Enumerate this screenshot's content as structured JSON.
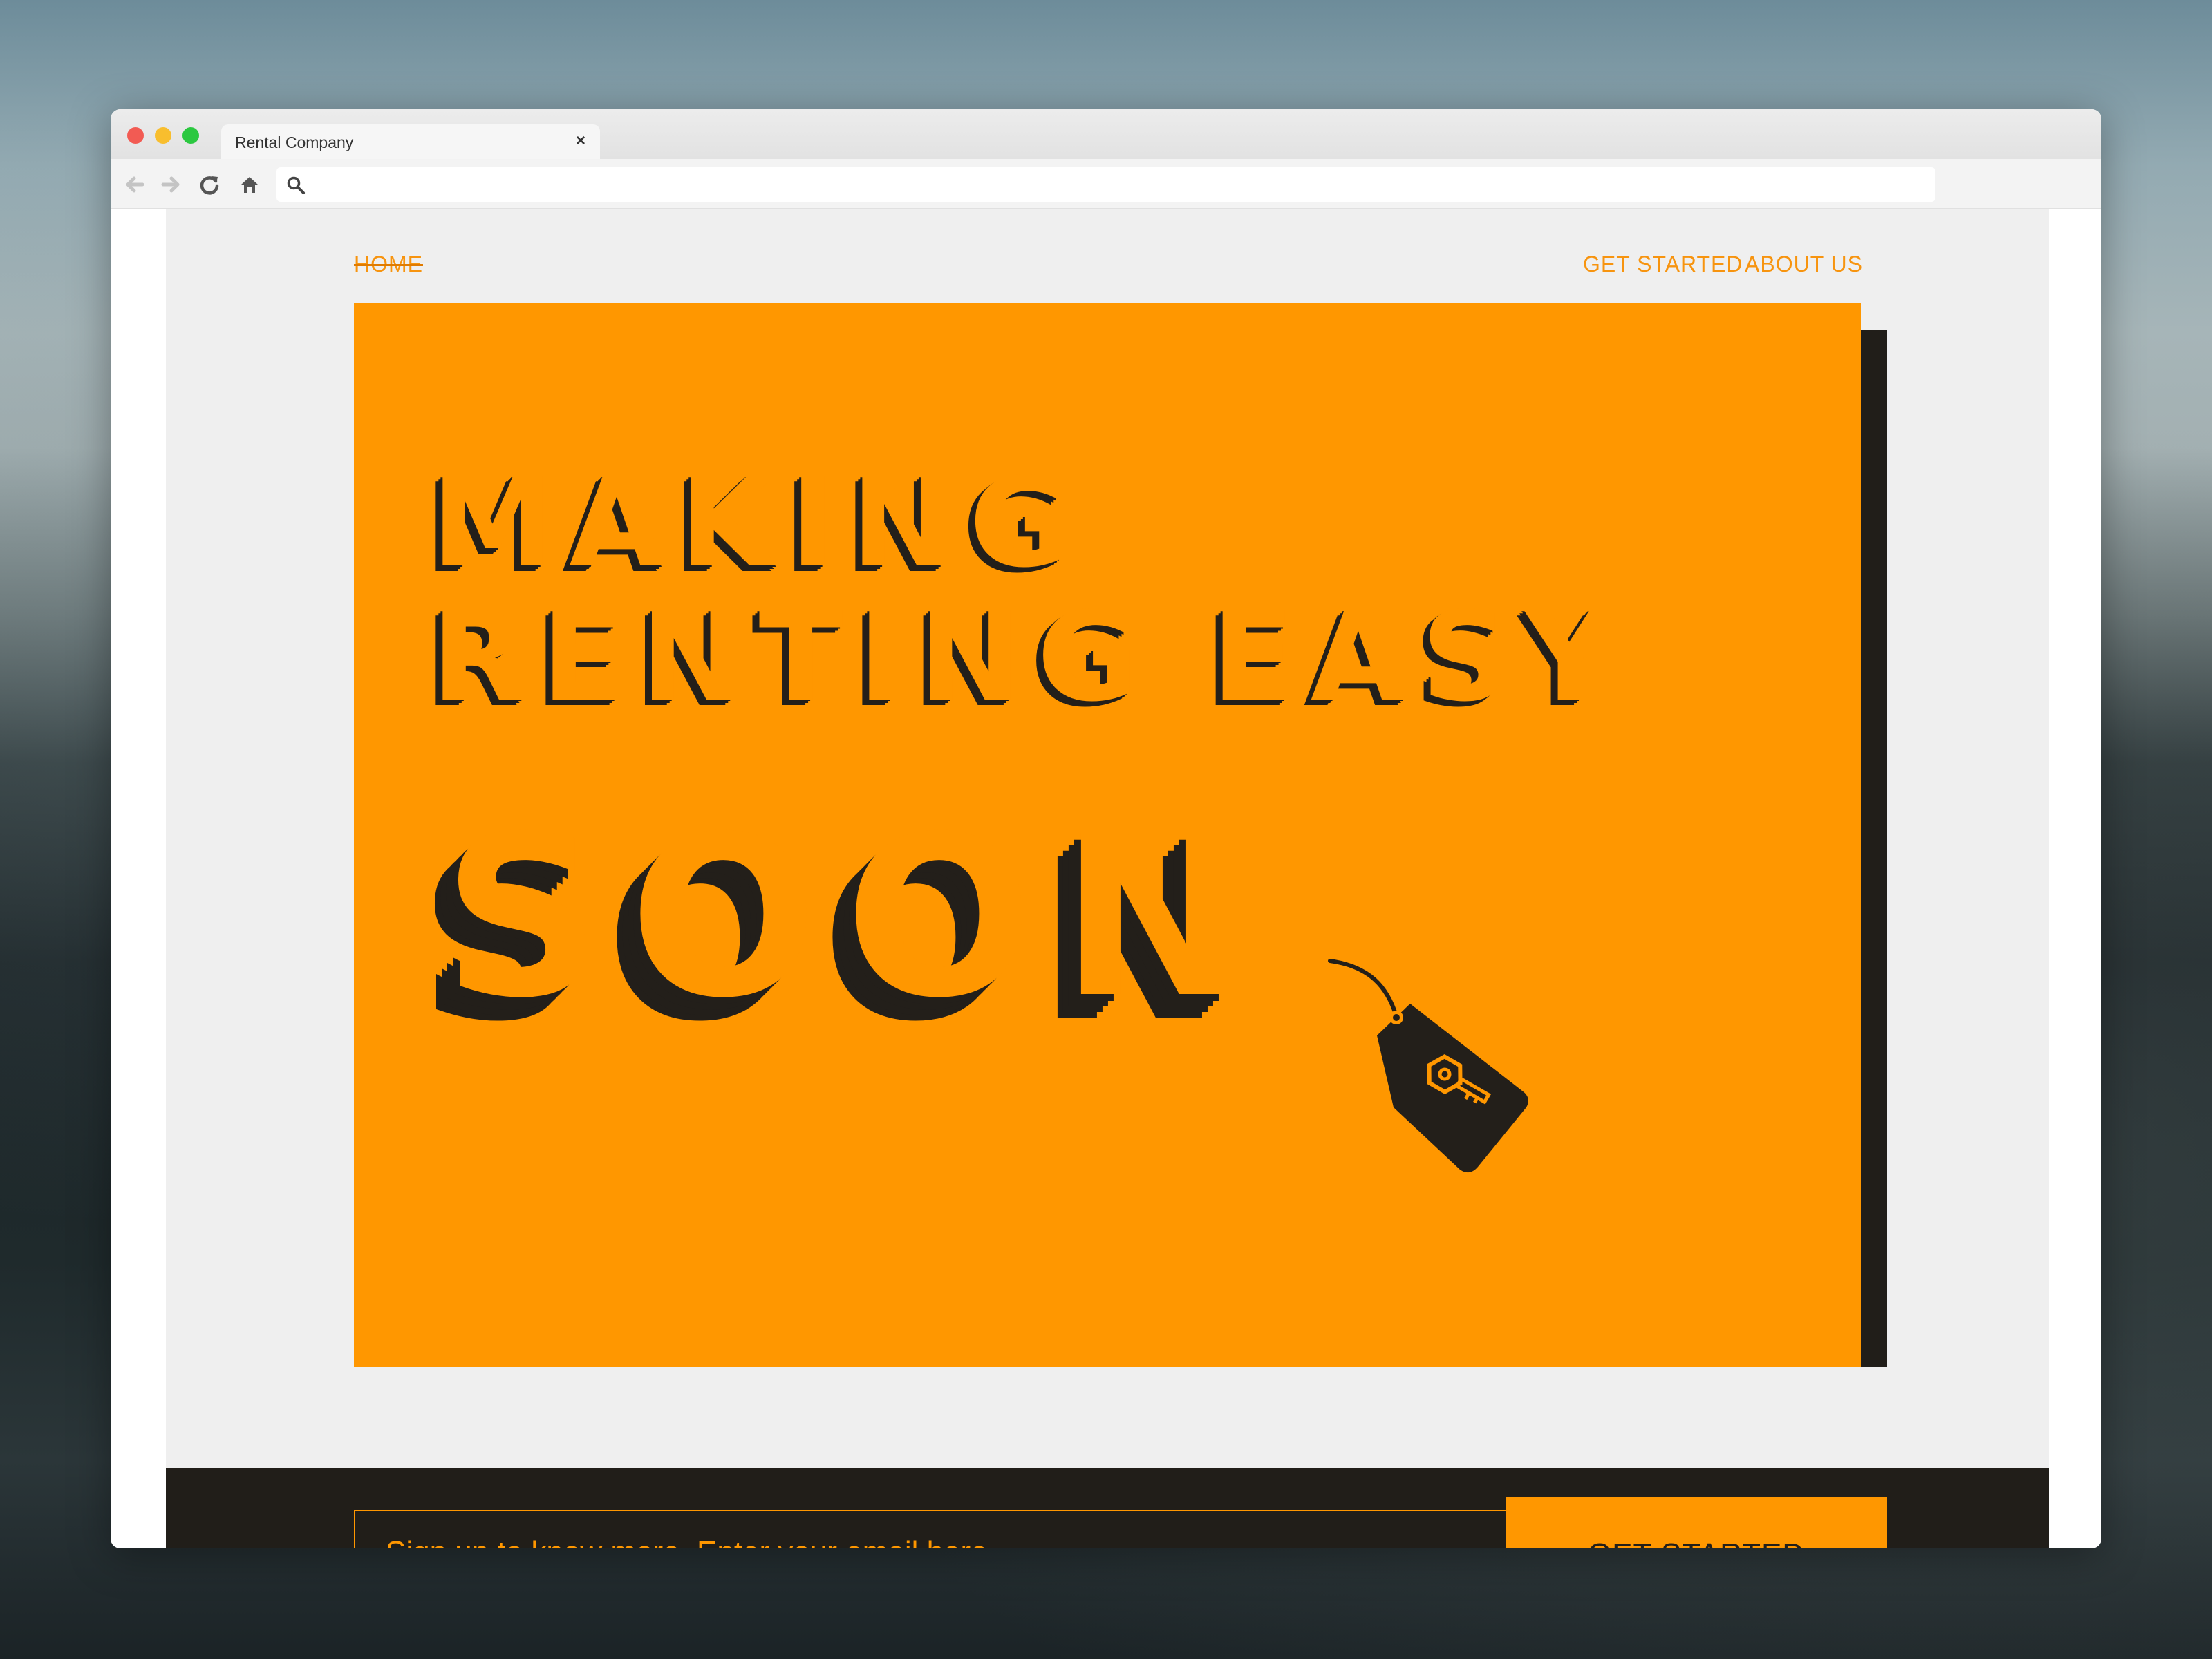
{
  "browser": {
    "tab_title": "Rental Company",
    "tab_close": "×",
    "address_value": "",
    "icons": [
      "back-arrow-icon",
      "forward-arrow-icon",
      "reload-icon",
      "home-icon",
      "search-icon"
    ]
  },
  "nav": {
    "home": "HOME",
    "get_started": "GET STARTED",
    "about": "ABOUT US"
  },
  "hero": {
    "line1": "MAKING",
    "line2": "RENTING EASY",
    "soon": "SOON",
    "tag_icon": "key-tag-icon"
  },
  "signup": {
    "placeholder": "Sign up to know more. Enter your email here.",
    "button": "GET STARTED"
  },
  "colors": {
    "accent": "#ff9700",
    "dark": "#211e19",
    "page_bg": "#efefef"
  }
}
